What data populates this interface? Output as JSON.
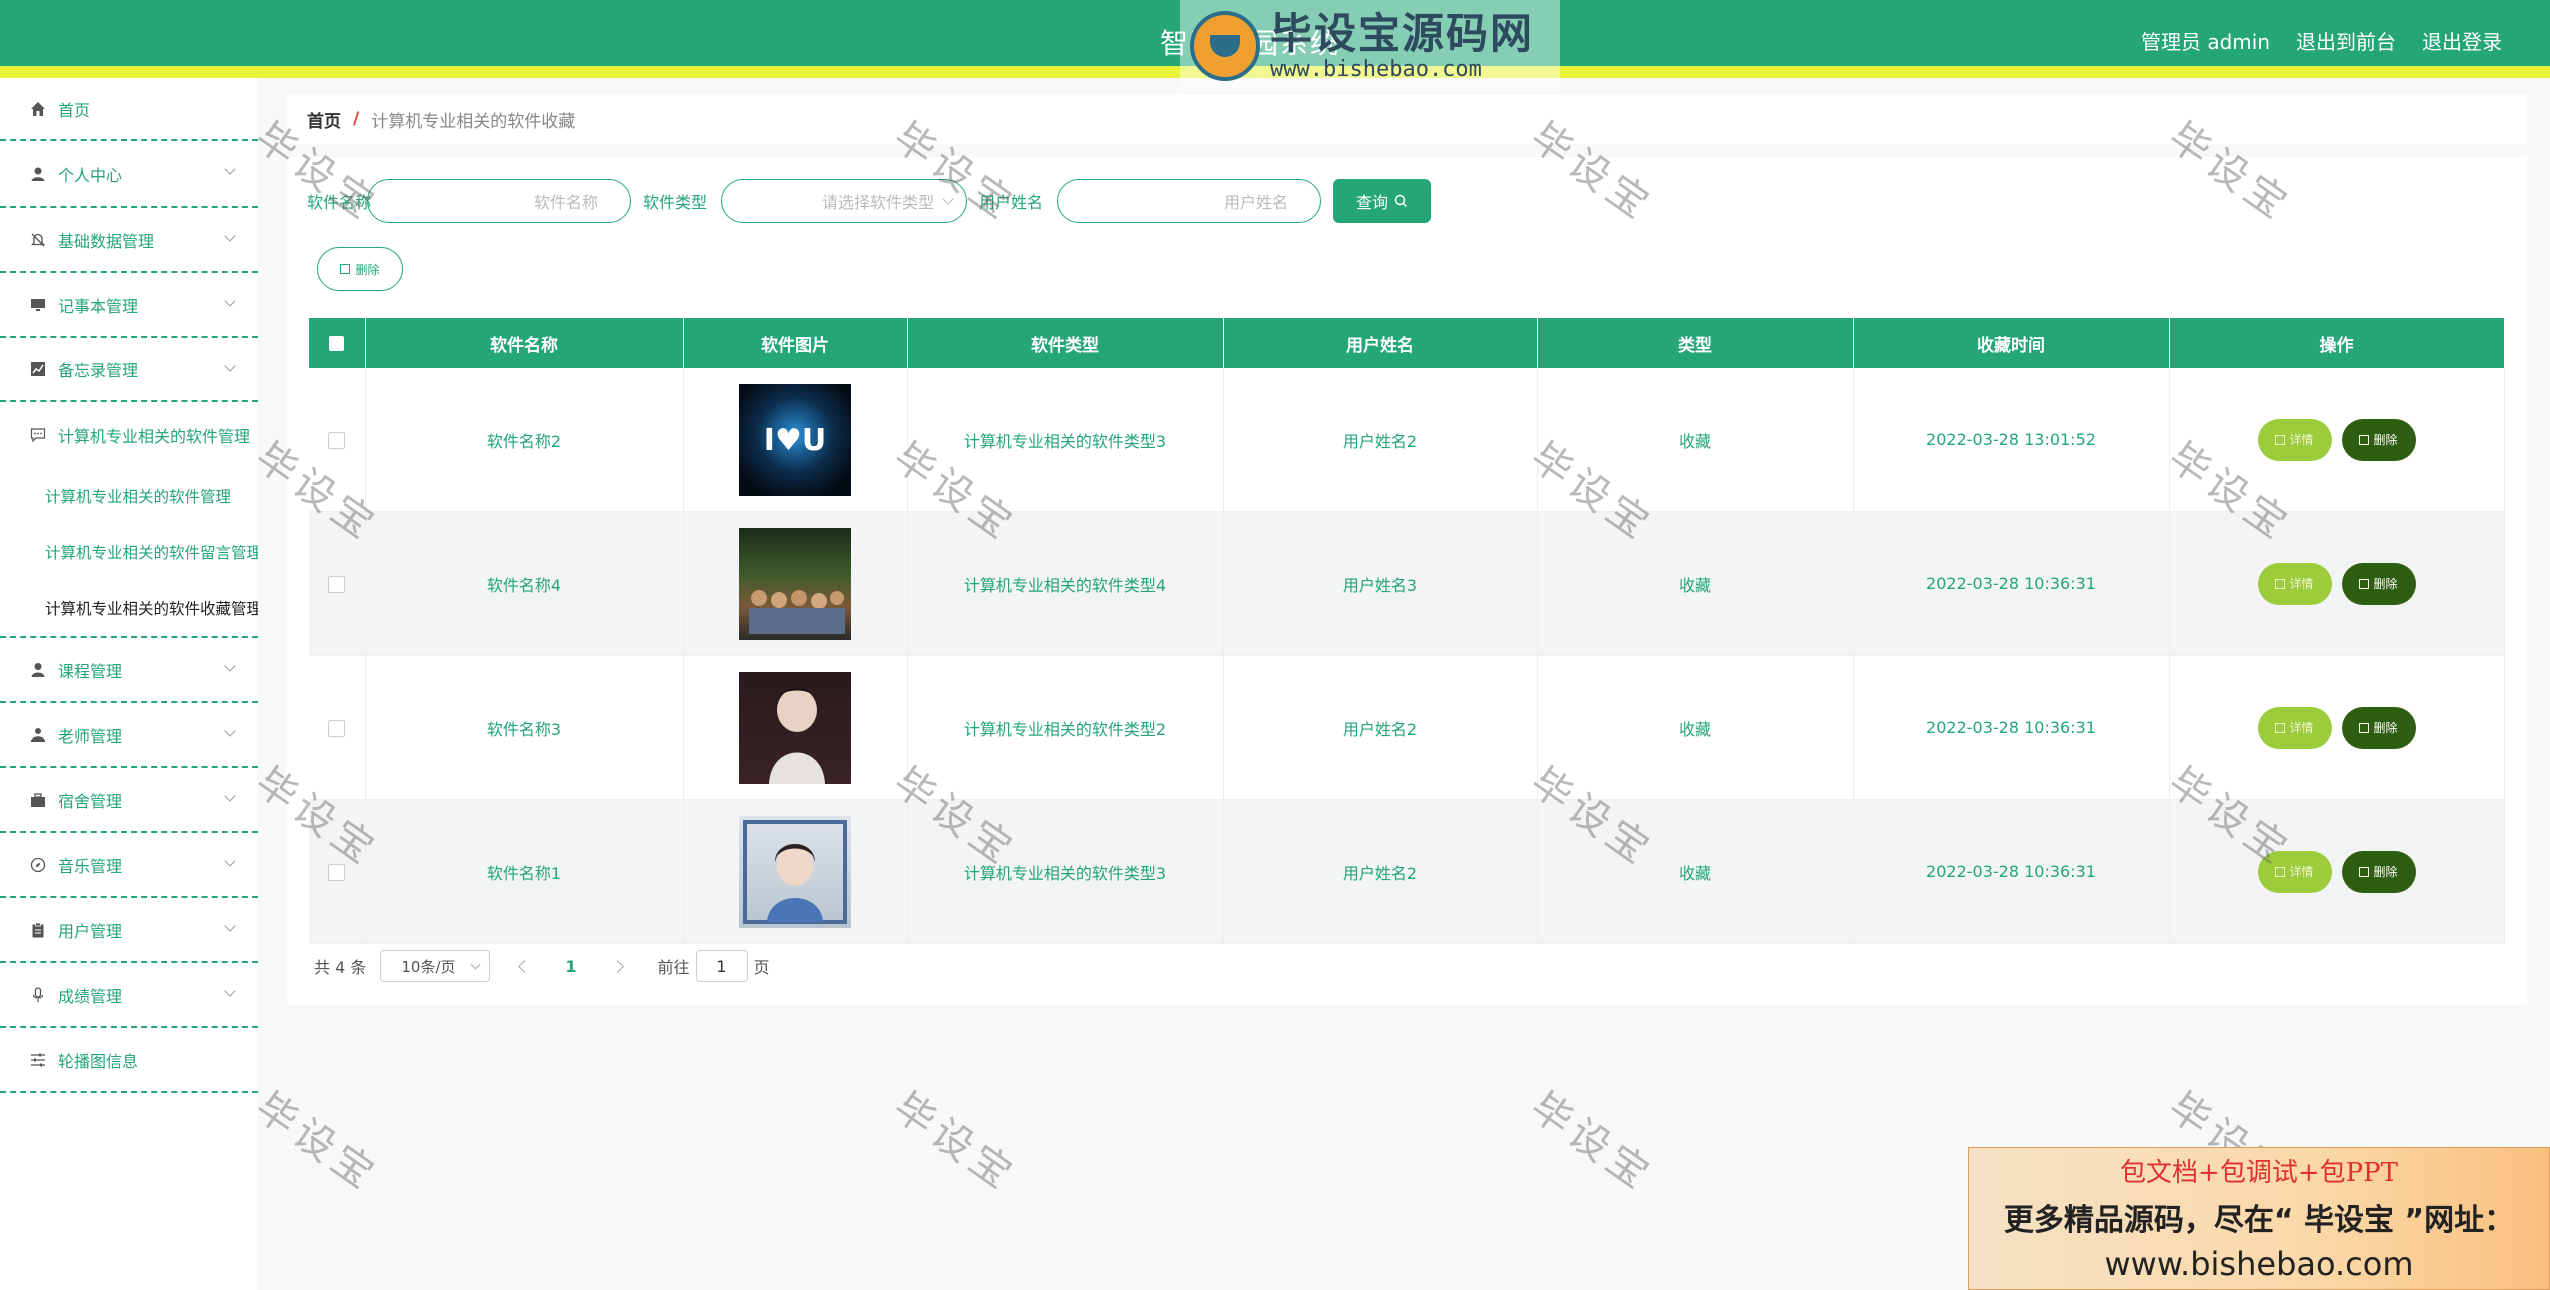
{
  "header": {
    "title": "智慧校园系统",
    "watermark_brand": "毕设宝源码网",
    "watermark_url": "www.bishebao.com",
    "user_label": "管理员 admin",
    "back_front": "退出到前台",
    "logout": "退出登录"
  },
  "sidebar": {
    "items": [
      {
        "label": "首页",
        "icon": "home-icon"
      },
      {
        "label": "个人中心",
        "icon": "user-icon"
      },
      {
        "label": "基础数据管理",
        "icon": "bell-off-icon"
      },
      {
        "label": "记事本管理",
        "icon": "monitor-icon"
      },
      {
        "label": "备忘录管理",
        "icon": "chart-icon"
      },
      {
        "label": "计算机专业相关的软件管理",
        "icon": "chat-icon"
      },
      {
        "label": "课程管理",
        "icon": "person-icon"
      },
      {
        "label": "老师管理",
        "icon": "teacher-icon"
      },
      {
        "label": "宿舍管理",
        "icon": "suitcase-icon"
      },
      {
        "label": "音乐管理",
        "icon": "compass-icon"
      },
      {
        "label": "用户管理",
        "icon": "clipboard-icon"
      },
      {
        "label": "成绩管理",
        "icon": "microphone-icon"
      },
      {
        "label": "轮播图信息",
        "icon": "sliders-icon"
      }
    ],
    "sub_items": [
      "计算机专业相关的软件管理",
      "计算机专业相关的软件留言管理",
      "计算机专业相关的软件收藏管理"
    ]
  },
  "breadcrumb": {
    "home": "首页",
    "separator": "/",
    "current": "计算机专业相关的软件收藏"
  },
  "search": {
    "name_label": "软件名称",
    "name_placeholder": "软件名称",
    "type_label": "软件类型",
    "type_placeholder": "请选择软件类型",
    "user_label": "用户姓名",
    "user_placeholder": "用户姓名",
    "query_button": "查询"
  },
  "toolbar": {
    "delete_label": "删除"
  },
  "table": {
    "headers": [
      "软件名称",
      "软件图片",
      "软件类型",
      "用户姓名",
      "类型",
      "收藏时间",
      "操作"
    ],
    "rows": [
      {
        "name": "软件名称2",
        "type": "计算机专业相关的软件类型3",
        "user": "用户姓名2",
        "kind": "收藏",
        "time": "2022-03-28 13:01:52"
      },
      {
        "name": "软件名称4",
        "type": "计算机专业相关的软件类型4",
        "user": "用户姓名3",
        "kind": "收藏",
        "time": "2022-03-28 10:36:31"
      },
      {
        "name": "软件名称3",
        "type": "计算机专业相关的软件类型2",
        "user": "用户姓名2",
        "kind": "收藏",
        "time": "2022-03-28 10:36:31"
      },
      {
        "name": "软件名称1",
        "type": "计算机专业相关的软件类型3",
        "user": "用户姓名2",
        "kind": "收藏",
        "time": "2022-03-28 10:36:31"
      }
    ],
    "detail_label": "详情",
    "delete_label": "删除"
  },
  "pager": {
    "total": "共 4 条",
    "page_size": "10条/页",
    "current_page": "1",
    "goto_prefix": "前往",
    "goto_value": "1",
    "goto_suffix": "页"
  },
  "watermark_text": "毕设宝",
  "ad": {
    "line1": "包文档+包调试+包PPT",
    "line2": "更多精品源码，尽在“ 毕设宝 ”网址：",
    "line3": "www.bishebao.com"
  },
  "colors": {
    "primary": "#24a676",
    "accent_bar": "#e8f236",
    "detail_btn": "#9ccc3c",
    "delete_btn": "#2e5e10"
  }
}
